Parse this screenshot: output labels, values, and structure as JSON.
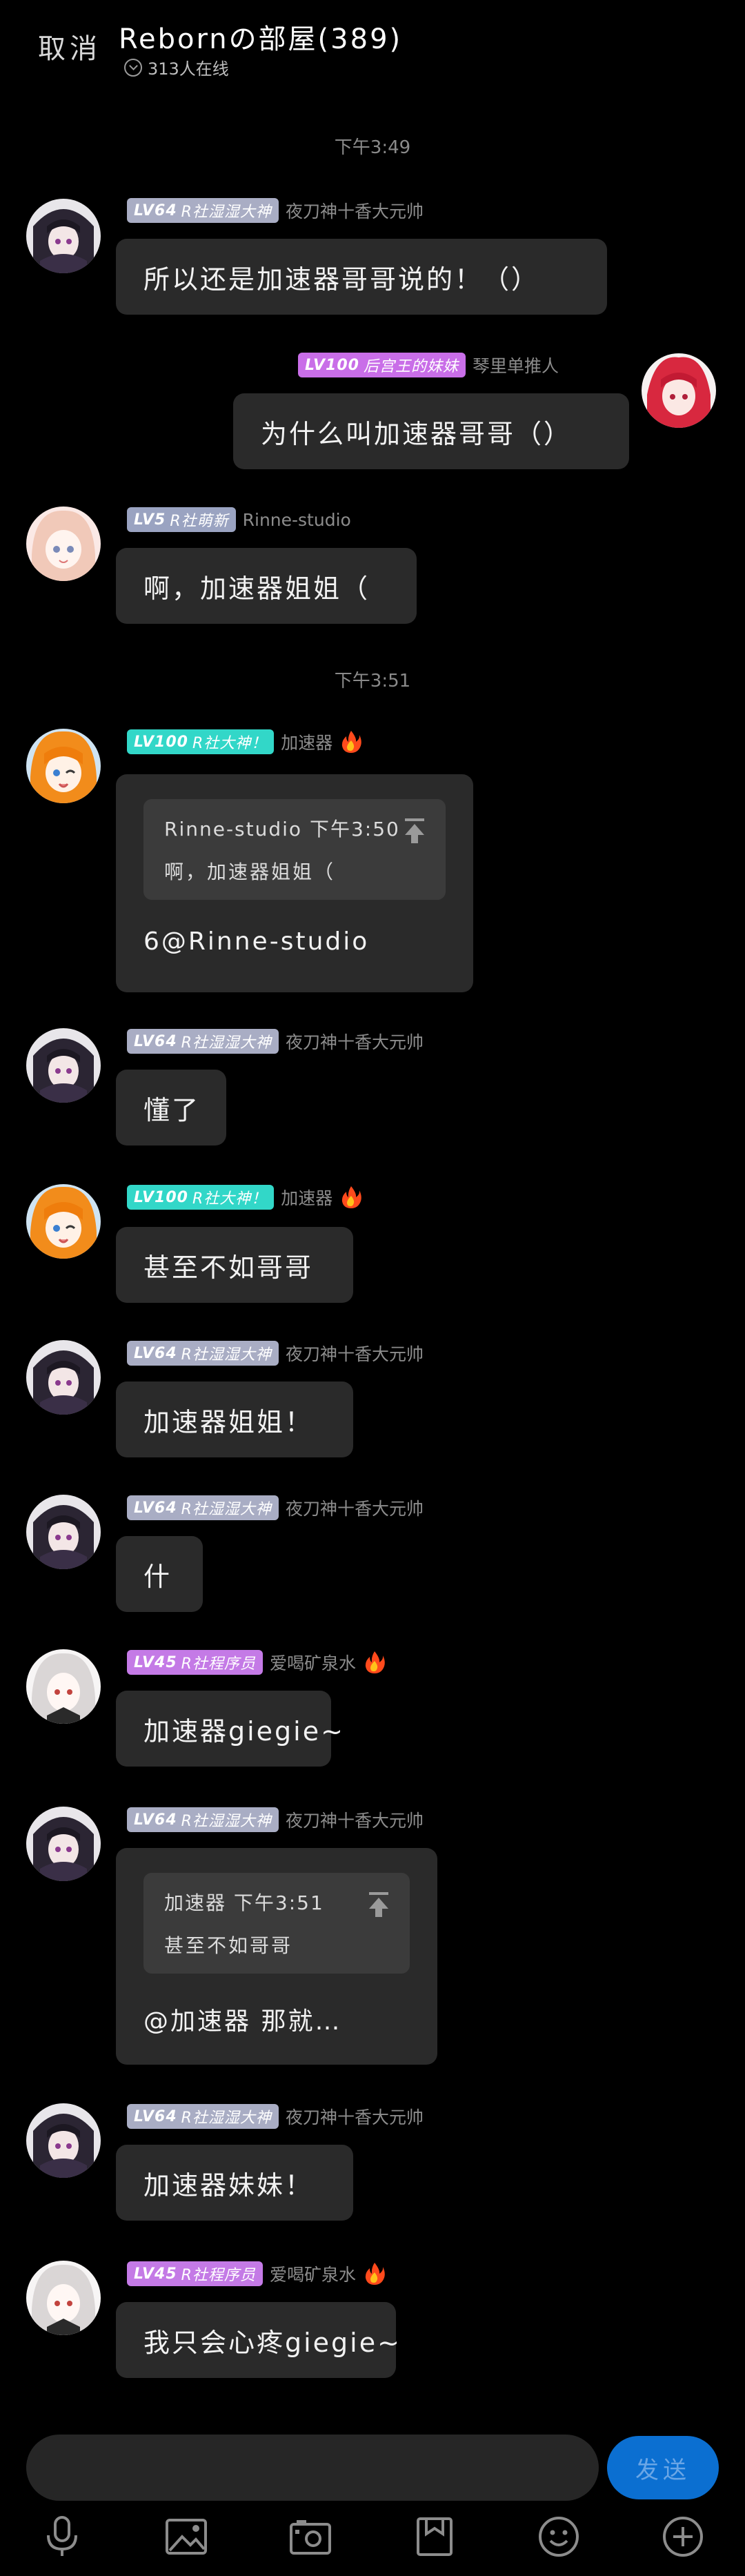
{
  "header": {
    "cancel_label": "取消",
    "room_title": "Rebornの部屋(389)",
    "online_count": "313人在线"
  },
  "colors": {
    "background": "#000000",
    "bubble": "#2a2a2a",
    "send_button": "#0b6fd1",
    "badge_lv64": "#a9adc4",
    "badge_lv100_purple": "#c96ee8",
    "badge_lv5": "#9aa3c1",
    "badge_lv100_cyan": "#32d7c8",
    "badge_lv45": "#c47ae6"
  },
  "timestamps": [
    "下午3:49",
    "下午3:51"
  ],
  "messages": [
    {
      "level": "LV64",
      "title": "R社湿湿大神",
      "nick": "夜刀神十香大元帅",
      "text": "所以还是加速器哥哥说的！（）"
    },
    {
      "level": "LV100",
      "title": "后宫王的妹妹",
      "nick": "琴里单推人",
      "text": "为什么叫加速器哥哥（）"
    },
    {
      "level": "LV5",
      "title": "R社萌新",
      "nick": "Rinne-studio",
      "text": "啊，加速器姐姐（"
    },
    {
      "level": "LV100",
      "title": "R社大神！",
      "nick": "加速器",
      "quote_head": "Rinne-studio 下午3:50",
      "quote_body": "啊，加速器姐姐（",
      "text": "6@Rinne-studio"
    },
    {
      "level": "LV64",
      "title": "R社湿湿大神",
      "nick": "夜刀神十香大元帅",
      "text": "懂了"
    },
    {
      "level": "LV100",
      "title": "R社大神！",
      "nick": "加速器",
      "text": "甚至不如哥哥"
    },
    {
      "level": "LV64",
      "title": "R社湿湿大神",
      "nick": "夜刀神十香大元帅",
      "text": "加速器姐姐！"
    },
    {
      "level": "LV64",
      "title": "R社湿湿大神",
      "nick": "夜刀神十香大元帅",
      "text": "什"
    },
    {
      "level": "LV45",
      "title": "R社程序员",
      "nick": "爱喝矿泉水",
      "text": "加速器giegie~"
    },
    {
      "level": "LV64",
      "title": "R社湿湿大神",
      "nick": "夜刀神十香大元帅",
      "quote_head": "加速器 下午3:51",
      "quote_body": "甚至不如哥哥",
      "text": "@加速器 那就…"
    },
    {
      "level": "LV64",
      "title": "R社湿湿大神",
      "nick": "夜刀神十香大元帅",
      "text": "加速器妹妹！"
    },
    {
      "level": "LV45",
      "title": "R社程序员",
      "nick": "爱喝矿泉水",
      "text": "我只会心疼giegie~"
    }
  ],
  "composer": {
    "send_label": "发送"
  },
  "toolbar_icons": [
    "microphone-icon",
    "image-icon",
    "camera-icon",
    "bookmark-icon",
    "emoji-icon",
    "plus-icon"
  ]
}
